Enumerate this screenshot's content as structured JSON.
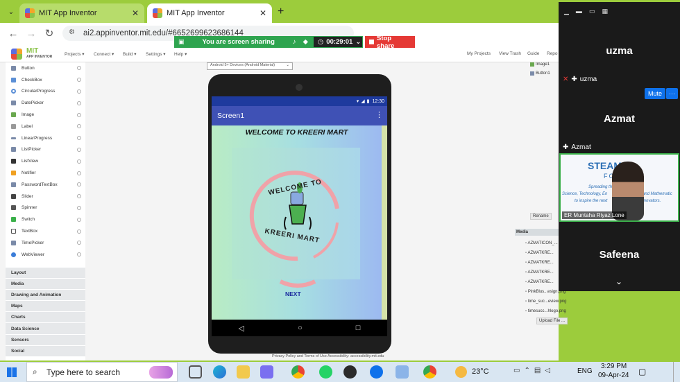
{
  "browser": {
    "tabs": [
      {
        "label": "MIT App Inventor"
      },
      {
        "label": "MIT App Inventor"
      }
    ],
    "new_tab": "+",
    "url": "ai2.appinventor.mit.edu/#6652699623686144"
  },
  "share_banner": {
    "text": "You are screen sharing",
    "timer": "00:29:01",
    "stop_label": "Stop share"
  },
  "ai_menu": {
    "logo_top": "MIT",
    "logo_bottom": "APP INVENTOR",
    "items": [
      "Projects ▾",
      "Connect ▾",
      "Build ▾",
      "Settings ▾",
      "Help ▾"
    ],
    "right_items": [
      "My Projects",
      "View Trash",
      "Guide",
      "Repo"
    ]
  },
  "palette": {
    "items": [
      "Button",
      "CheckBox",
      "CircularProgress",
      "DatePicker",
      "Image",
      "Label",
      "LinearProgress",
      "ListPicker",
      "ListView",
      "Notifier",
      "PasswordTextBox",
      "Slider",
      "Spinner",
      "Switch",
      "TextBox",
      "TimePicker",
      "WebViewer"
    ],
    "categories": [
      "Layout",
      "Media",
      "Drawing and Animation",
      "Maps",
      "Charts",
      "Data Science",
      "Sensors",
      "Social"
    ]
  },
  "viewer": {
    "device_select": "Android 5+ Devices (Android Material)",
    "status_time": "12:30",
    "screen_title": "Screen1",
    "welcome_text": "WELCOME TO KREERI MART",
    "logo_top_text": "WELCOME TO",
    "logo_bottom_text": "KREERI MART",
    "next_button": "NEXT",
    "footer": "Privacy Policy and Terms of Use        Accessibility: accessibility.mit.edu"
  },
  "components_panel": {
    "tree": [
      "Image1",
      "Button1"
    ],
    "rename_label": "Rename",
    "media_title": "Media",
    "media_items": [
      "AZMATICON_...",
      "AZMATKRE...",
      "AZMATKRE...",
      "AZMATKRE...",
      "AZMATKRE...",
      "PinkBlus...esign.png",
      "time_suc...eview.png",
      "timesucc...hlogo.png"
    ],
    "upload_label": "Upload File ..."
  },
  "meeting": {
    "participants": [
      {
        "name": "uzma",
        "label": "uzma"
      },
      {
        "name": "Azmat",
        "label": "Azmat"
      },
      {
        "name": "Safeena",
        "label": "Safeena"
      }
    ],
    "mute_label": "Mute",
    "more_label": "···",
    "video_caption": "ER Muntaha Riyaz Lone",
    "video_bg_text_1": "STEAM",
    "video_bg_text_2": "FOUN",
    "video_bg_text_3": "Spreading th",
    "video_bg_text_4": "Science, Technology, En",
    "video_bg_text_5": "and Mathematic",
    "video_bg_text_6": "to inspire the next",
    "video_bg_text_7": "innovators."
  },
  "taskbar": {
    "search_placeholder": "Type here to search",
    "temperature": "23°C",
    "language": "ENG",
    "time": "3:29 PM",
    "date": "09-Apr-24"
  },
  "colors": {
    "chrome_frame": "#9ccc3c",
    "share_green": "#2ea44f",
    "stop_red": "#e53935",
    "app_bar": "#3f51b5",
    "next_text": "#1a2a9e"
  }
}
